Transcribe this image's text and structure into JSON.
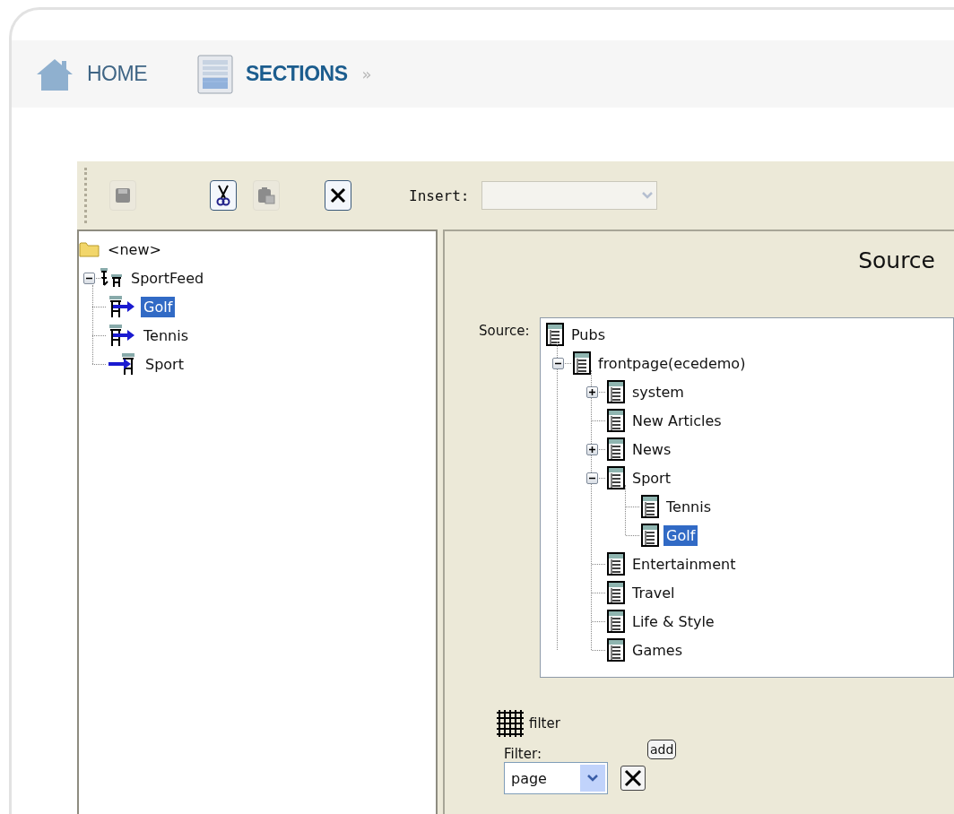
{
  "nav": {
    "items": [
      {
        "label": "HOME",
        "kind": "home",
        "selected": false
      },
      {
        "label": "SECTIONS",
        "kind": "sections",
        "selected": true
      }
    ],
    "separator": "»"
  },
  "toolbar": {
    "buttons": [
      {
        "kind": "save",
        "disabled": true
      },
      {
        "kind": "cut",
        "disabled": false
      },
      {
        "kind": "paste",
        "disabled": true
      },
      {
        "kind": "delete",
        "disabled": false
      }
    ],
    "insert": {
      "label": "Insert:",
      "disabled": true
    }
  },
  "left_tree": {
    "items": [
      {
        "label": "<new>",
        "kind": "folder",
        "selected": false
      },
      {
        "label": "SportFeed",
        "kind": "feed",
        "selected": false,
        "expanded": true,
        "children": [
          {
            "label": "Golf",
            "kind": "incoming",
            "selected": true
          },
          {
            "label": "Tennis",
            "kind": "incoming",
            "selected": false
          },
          {
            "label": "Sport",
            "kind": "outgoing",
            "selected": false
          }
        ]
      }
    ]
  },
  "source_panel": {
    "title": "Source",
    "source_label": "Source:",
    "tree": [
      {
        "label": "Pubs",
        "selected": false,
        "children": [
          {
            "label": "frontpage(ecedemo)",
            "selected": false,
            "expanded": true,
            "children": [
              {
                "label": "system",
                "selected": false,
                "expanded": false
              },
              {
                "label": "New Articles",
                "selected": false
              },
              {
                "label": "News",
                "selected": false,
                "expanded": false
              },
              {
                "label": "Sport",
                "selected": false,
                "expanded": true,
                "children": [
                  {
                    "label": "Tennis",
                    "selected": false
                  },
                  {
                    "label": "Golf",
                    "selected": true
                  }
                ]
              },
              {
                "label": "Entertainment",
                "selected": false
              },
              {
                "label": "Travel",
                "selected": false
              },
              {
                "label": "Life & Style",
                "selected": false
              },
              {
                "label": "Games",
                "selected": false
              }
            ]
          }
        ]
      }
    ]
  },
  "filter": {
    "heading": "filter",
    "label": "Filter:",
    "add_button": "add",
    "value": "page"
  }
}
